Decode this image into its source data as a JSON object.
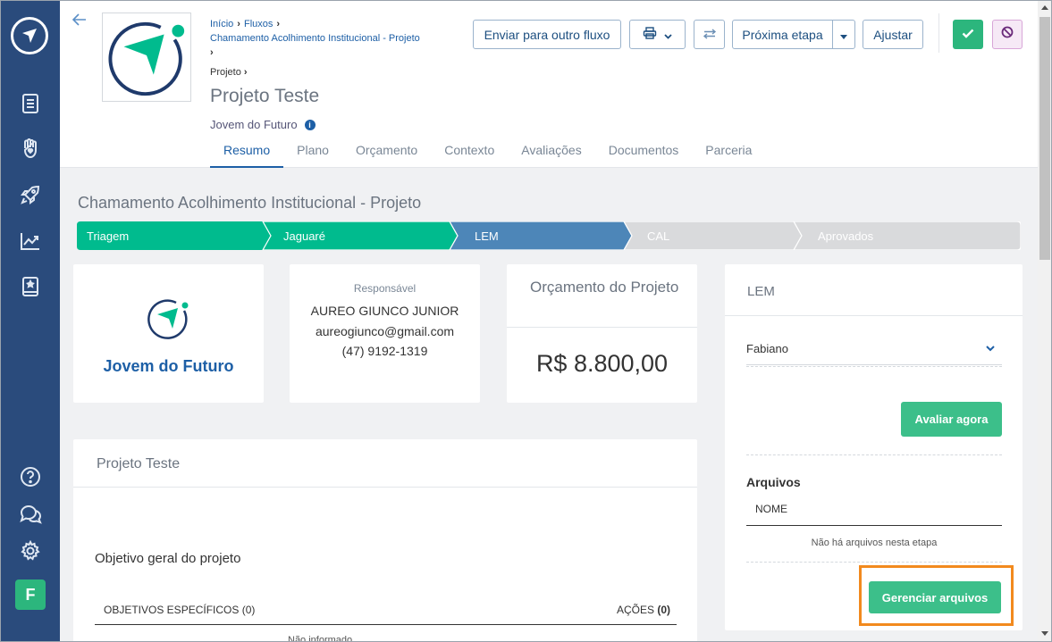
{
  "breadcrumbs": [
    "Início",
    "Fluxos",
    "Chamamento Acolhimento Institucional - Projeto"
  ],
  "sub_breadcrumb": "Projeto",
  "project_title": "Projeto Teste",
  "organization": "Jovem do Futuro",
  "toolbar": {
    "send_label": "Enviar para outro fluxo",
    "next_label": "Próxima etapa",
    "adjust_label": "Ajustar"
  },
  "tabs": [
    "Resumo",
    "Plano",
    "Orçamento",
    "Contexto",
    "Avaliações",
    "Documentos",
    "Parceria"
  ],
  "flow_title": "Chamamento Acolhimento Institucional - Projeto",
  "steps": [
    {
      "label": "Triagem",
      "state": "done"
    },
    {
      "label": "Jaguaré",
      "state": "done"
    },
    {
      "label": "LEM",
      "state": "current"
    },
    {
      "label": "CAL",
      "state": "pending"
    },
    {
      "label": "Aprovados",
      "state": "pending"
    }
  ],
  "org_card": {
    "name": "Jovem do Futuro"
  },
  "responsible": {
    "label": "Responsável",
    "name": "AUREO GIUNCO JUNIOR",
    "email": "aureogiunco@gmail.com",
    "phone": "(47) 9192-1319"
  },
  "budget": {
    "label": "Orçamento do Projeto",
    "amount": "R$ 8.800,00"
  },
  "project_card": {
    "title": "Projeto Teste",
    "objective": "Objetivo geral do projeto",
    "specific_header": "OBJETIVOS ESPECÍFICOS (0)",
    "actions_label": "AÇÕES",
    "actions_count": "(0)",
    "partial_text": "Não informado"
  },
  "stage_panel": {
    "title": "LEM",
    "evaluator": "Fabiano",
    "evaluate_label": "Avaliar agora",
    "files_title": "Arquivos",
    "files_col": "NOME",
    "files_empty": "Não há arquivos nesta etapa",
    "manage_label": "Gerenciar arquivos"
  },
  "colors": {
    "sidebar": "#2a4b7c",
    "primary": "#1d5fa6",
    "step_done": "#00bb8e",
    "step_current": "#4d86b8",
    "step_pending": "#d9dadc",
    "success": "#3cbf8a",
    "highlight": "#f28a1e"
  },
  "icons": [
    "app-logo-icon",
    "document-icon",
    "hand-heart-icon",
    "rocket-icon",
    "chart-icon",
    "book-icon",
    "help-icon",
    "chat-icon",
    "gear-icon",
    "back-arrow-icon",
    "printer-icon",
    "swap-icon",
    "check-icon",
    "block-icon",
    "info-icon",
    "chevron-down-icon"
  ],
  "user_initial": "F"
}
